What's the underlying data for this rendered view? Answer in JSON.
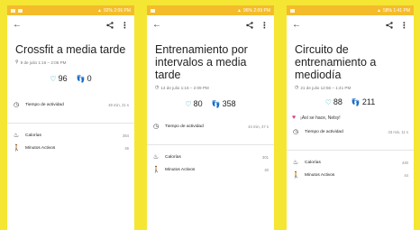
{
  "screens": [
    {
      "status": {
        "right": "92% 2:06 PM"
      },
      "title": "Crossfit a media tarde",
      "subtitle": "9 de julio 1:16 – 2:06 PM",
      "subtitle_icon": "run-icon",
      "stats": {
        "heart": "96",
        "steps": "0"
      },
      "rows": [
        {
          "label": "Tiempo de actividad",
          "value": "49 min, 21 s"
        },
        {
          "label": "Calorías",
          "value": "364"
        },
        {
          "label": "Minutos Activos",
          "value": "46"
        }
      ]
    },
    {
      "status": {
        "right": "96% 2:09 PM"
      },
      "title": "Entrenamiento por intervalos a media tarde",
      "subtitle": "14 de julio 1:16 – 2:09 PM",
      "subtitle_icon": "clock-icon",
      "stats": {
        "heart": "80",
        "steps": "358"
      },
      "rows": [
        {
          "label": "Tiempo de actividad",
          "value": "44 min, 47 s"
        },
        {
          "label": "Calorías",
          "value": "301"
        },
        {
          "label": "Minutos Activos",
          "value": "40"
        }
      ]
    },
    {
      "status": {
        "right": "58% 1:41 PM"
      },
      "title": "Circuito de entrenamiento a mediodía",
      "subtitle": "21 de julio 12:56 – 1:41 PM",
      "subtitle_icon": "clock-icon",
      "stats": {
        "heart": "88",
        "steps": "211"
      },
      "message": "¡Así se hace, Nelsy!",
      "rows": [
        {
          "label": "Tiempo de actividad",
          "value": "43 min, 11 s"
        },
        {
          "label": "Calorías",
          "value": "440"
        },
        {
          "label": "Minutos Activos",
          "value": "44"
        }
      ]
    }
  ],
  "colors": {
    "frame": "#f5e634",
    "statusbar": "#f4bc2a",
    "heart": "#1aa3c1",
    "steps": "#3e84d6",
    "message_heart": "#d93b8a"
  }
}
